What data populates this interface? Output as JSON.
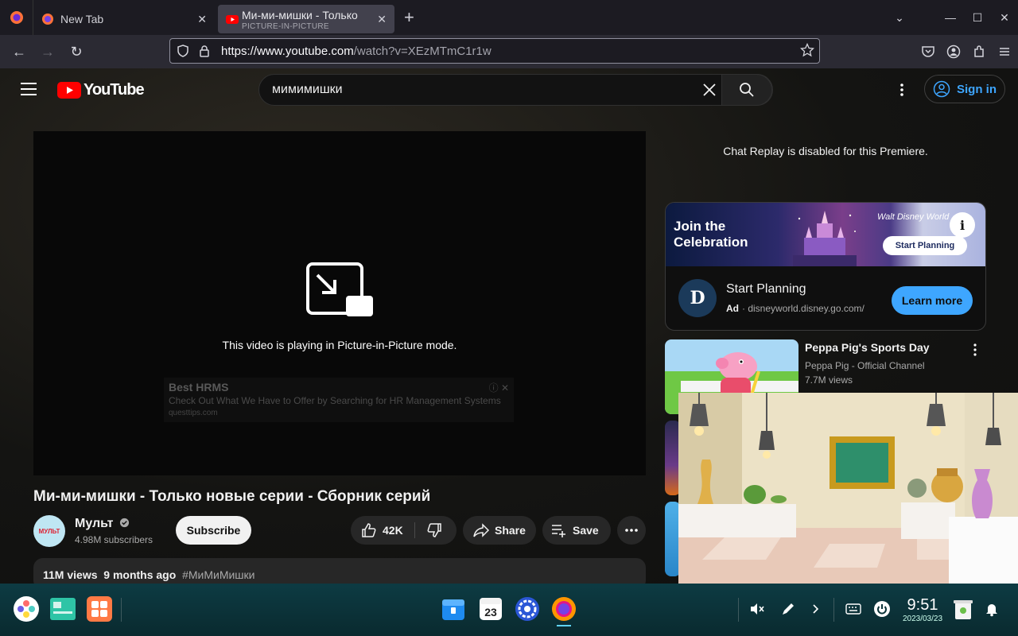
{
  "browser": {
    "tabs": [
      {
        "label": "New Tab",
        "active": false
      },
      {
        "label": "Ми-ми-мишки - Только",
        "sublabel": "PICTURE-IN-PICTURE",
        "active": true
      }
    ],
    "url_host": "https://www.youtube.com",
    "url_path": "/watch?v=XEzMTmC1r1w"
  },
  "youtube": {
    "logo_text": "YouTube",
    "search_query": "мимимишки",
    "sign_in": "Sign in",
    "player": {
      "pip_message": "This video is playing in Picture-in-Picture mode.",
      "ad_title": "Best HRMS",
      "ad_text": "Check Out What We Have to Offer by Searching for HR Management Systems",
      "ad_domain": "questtips.com"
    },
    "video_title": "Ми-ми-мишки - Только новые серии - Сборник серий",
    "channel": {
      "name": "Мульт",
      "avatar_text": "МУЛЬТ",
      "subscribers": "4.98M subscribers",
      "subscribe_label": "Subscribe"
    },
    "actions": {
      "likes": "42K",
      "share": "Share",
      "save": "Save"
    },
    "description": {
      "views": "11M views",
      "age": "9 months ago",
      "hashtag": "#МиМиМишки"
    },
    "chat_note": "Chat Replay is disabled for this Premiere.",
    "ad_card": {
      "banner_title_line1": "Join the",
      "banner_title_line2": "Celebration",
      "banner_brand": "Walt Disney World",
      "banner_button": "Start Planning",
      "title": "Start Planning",
      "ad_label": "Ad",
      "domain": "disneyworld.disney.go.com/",
      "cta": "Learn more"
    },
    "recommendations": [
      {
        "title": "Peppa Pig's Sports Day",
        "channel": "Peppa Pig - Official Channel",
        "views": "7.7M views"
      }
    ]
  },
  "taskbar": {
    "time": "9:51",
    "date": "2023/03/23",
    "calendar_day": "23"
  },
  "colors": {
    "accent_blue": "#3ea6ff",
    "yt_red": "#ff0000",
    "taskbar_teal": "#0d3b43"
  }
}
